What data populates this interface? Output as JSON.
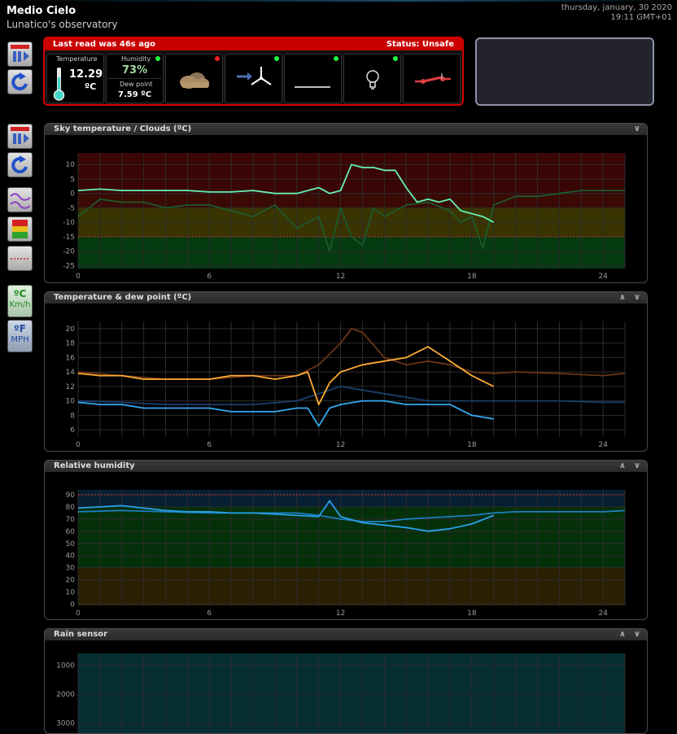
{
  "site": {
    "title": "Medio Cielo",
    "subtitle": "Lunatico's observatory"
  },
  "datetime": {
    "date": "thursday, january, 30 2020",
    "time": "19:11 GMT+01"
  },
  "status": {
    "last_read": "Last read was 46s ago",
    "status": "Status: Unsafe",
    "temperature_label": "Temperature",
    "temperature_value": "12.29",
    "temperature_unit": "ºC",
    "humidity_label": "Humidity",
    "humidity_value": "73%",
    "dewpoint_label": "Dew point",
    "dewpoint_value": "7.59 ºC",
    "tiles": [
      {
        "icon": "cloud-icon",
        "dot": "#ff2020"
      },
      {
        "icon": "wind-icon",
        "dot": "#20ff40"
      },
      {
        "icon": "rain-icon",
        "dot": "#20ff40"
      },
      {
        "icon": "lightbulb-icon",
        "dot": "#20ff40"
      },
      {
        "icon": "switch-icon"
      }
    ]
  },
  "units": {
    "metric_top": "ºC",
    "metric_sub": "Km/h",
    "imperial_top": "ºF",
    "imperial_sub": "MPH"
  },
  "x_ticks": [
    "0",
    "6",
    "12",
    "18",
    "24"
  ],
  "panels": {
    "sky": {
      "title": "Sky temperature / Clouds (ºC)",
      "y_ticks": [
        "10",
        "5",
        "0",
        "-5",
        "-10",
        "-15",
        "-20",
        "-25"
      ]
    },
    "temp": {
      "title": "Temperature & dew point (ºC)",
      "y_ticks": [
        "20",
        "18",
        "16",
        "14",
        "12",
        "10",
        "8",
        "6"
      ]
    },
    "hum": {
      "title": "Relative humidity",
      "y_ticks": [
        "90",
        "80",
        "70",
        "60",
        "50",
        "40",
        "30",
        "20",
        "10",
        "0"
      ]
    },
    "rain": {
      "title": "Rain sensor",
      "y_ticks": [
        "1000",
        "2000",
        "3000"
      ]
    }
  },
  "chart_data": [
    {
      "type": "line",
      "title": "Sky temperature / Clouds (ºC)",
      "xlim": [
        0,
        25
      ],
      "ylim": [
        -26,
        14
      ],
      "series": [
        {
          "color": "#64f0b4",
          "x": [
            0,
            1,
            2,
            3,
            4,
            5,
            6,
            7,
            8,
            9,
            10,
            11,
            11.5,
            12,
            12.5,
            13,
            13.5,
            14,
            14.5,
            15,
            15.5,
            16,
            16.5,
            17,
            17.5,
            18,
            18.5,
            19
          ],
          "values": [
            1,
            1.5,
            1,
            1,
            1,
            1,
            0.5,
            0.5,
            1,
            0,
            0,
            2,
            0,
            1,
            10,
            9,
            9,
            8,
            8,
            2,
            -3,
            -2,
            -3,
            -2,
            -6,
            -7,
            -8,
            -10
          ]
        },
        {
          "color": "#1c5a2c",
          "x": [
            0,
            1,
            2,
            3,
            4,
            5,
            6,
            7,
            8,
            9,
            10,
            11,
            11.5,
            12,
            12.5,
            13,
            13.5,
            14,
            14.5,
            15,
            16,
            17,
            17.5,
            18,
            18.5,
            19,
            20,
            21,
            22,
            23,
            24,
            25
          ],
          "values": [
            -8,
            -2,
            -3,
            -3,
            -5,
            -4,
            -4,
            -6,
            -8,
            -4,
            -12,
            -8,
            -20,
            -5,
            -15,
            -18,
            -5,
            -8,
            -6,
            -4,
            -3,
            -6,
            -10,
            -8,
            -19,
            -4,
            -1,
            -1,
            0,
            1,
            1,
            1
          ]
        }
      ]
    },
    {
      "type": "line",
      "title": "Temperature & dew point (ºC)",
      "xlim": [
        0,
        25
      ],
      "ylim": [
        5,
        21
      ],
      "series": [
        {
          "color": "#ffaa33",
          "x": [
            0,
            1,
            2,
            3,
            4,
            5,
            6,
            7,
            8,
            9,
            10,
            10.5,
            11,
            11.5,
            12,
            13,
            14,
            15,
            16,
            17,
            18,
            19
          ],
          "values": [
            13.8,
            13.5,
            13.5,
            13,
            13,
            13,
            13,
            13.5,
            13.5,
            13,
            13.5,
            14,
            9.5,
            12.5,
            14,
            15,
            15.5,
            16,
            17.5,
            15.5,
            13.5,
            12
          ]
        },
        {
          "color": "#6b3517",
          "x": [
            0,
            2,
            4,
            6,
            8,
            10,
            11,
            12,
            12.5,
            13,
            14,
            15,
            16,
            17,
            18,
            19,
            20,
            22,
            24,
            25
          ],
          "values": [
            14,
            13.5,
            13,
            13,
            13.5,
            13.5,
            15,
            18,
            20,
            19.5,
            16,
            15,
            15.5,
            15,
            14,
            13.8,
            14,
            13.8,
            13.5,
            13.8
          ]
        },
        {
          "color": "#33aaf0",
          "x": [
            0,
            1,
            2,
            3,
            4,
            5,
            6,
            7,
            8,
            9,
            10,
            10.5,
            11,
            11.5,
            12,
            13,
            14,
            15,
            16,
            17,
            18,
            19
          ],
          "values": [
            9.8,
            9.5,
            9.5,
            9,
            9,
            9,
            9,
            8.5,
            8.5,
            8.5,
            9,
            9,
            6.5,
            9,
            9.5,
            10,
            10,
            9.5,
            9.5,
            9.5,
            8,
            7.5
          ]
        },
        {
          "color": "#1a3f6c",
          "x": [
            0,
            2,
            4,
            6,
            8,
            10,
            11,
            12,
            13,
            14,
            16,
            18,
            20,
            22,
            24,
            25
          ],
          "values": [
            10,
            9.8,
            9.5,
            9.5,
            9.5,
            10,
            11,
            12,
            11.5,
            11,
            10,
            10,
            10,
            10,
            9.8,
            9.8
          ]
        }
      ]
    },
    {
      "type": "line",
      "title": "Relative humidity",
      "xlim": [
        0,
        25
      ],
      "ylim": [
        -1,
        94
      ],
      "series": [
        {
          "color": "#2aa0e8",
          "x": [
            0,
            1,
            2,
            3,
            4,
            5,
            6,
            7,
            8,
            9,
            10,
            11,
            11.5,
            12,
            13,
            14,
            15,
            16,
            17,
            18,
            19
          ],
          "values": [
            79,
            80,
            81,
            79,
            77,
            76,
            76,
            75,
            75,
            74,
            73,
            72,
            85,
            72,
            67,
            65,
            63,
            60,
            62,
            66,
            73
          ]
        },
        {
          "color": "#1e7fc0",
          "x": [
            0,
            2,
            4,
            6,
            8,
            10,
            11,
            12,
            13,
            14,
            15,
            16,
            17,
            18,
            19,
            20,
            22,
            24,
            25
          ],
          "values": [
            76,
            77,
            76,
            75,
            75,
            75,
            73,
            70,
            68,
            68,
            70,
            71,
            72,
            73,
            75,
            76,
            76,
            76,
            77
          ]
        }
      ]
    },
    {
      "type": "line",
      "title": "Rain sensor",
      "xlim": [
        0,
        25
      ],
      "ylim": [
        3400,
        600
      ],
      "series": []
    }
  ]
}
